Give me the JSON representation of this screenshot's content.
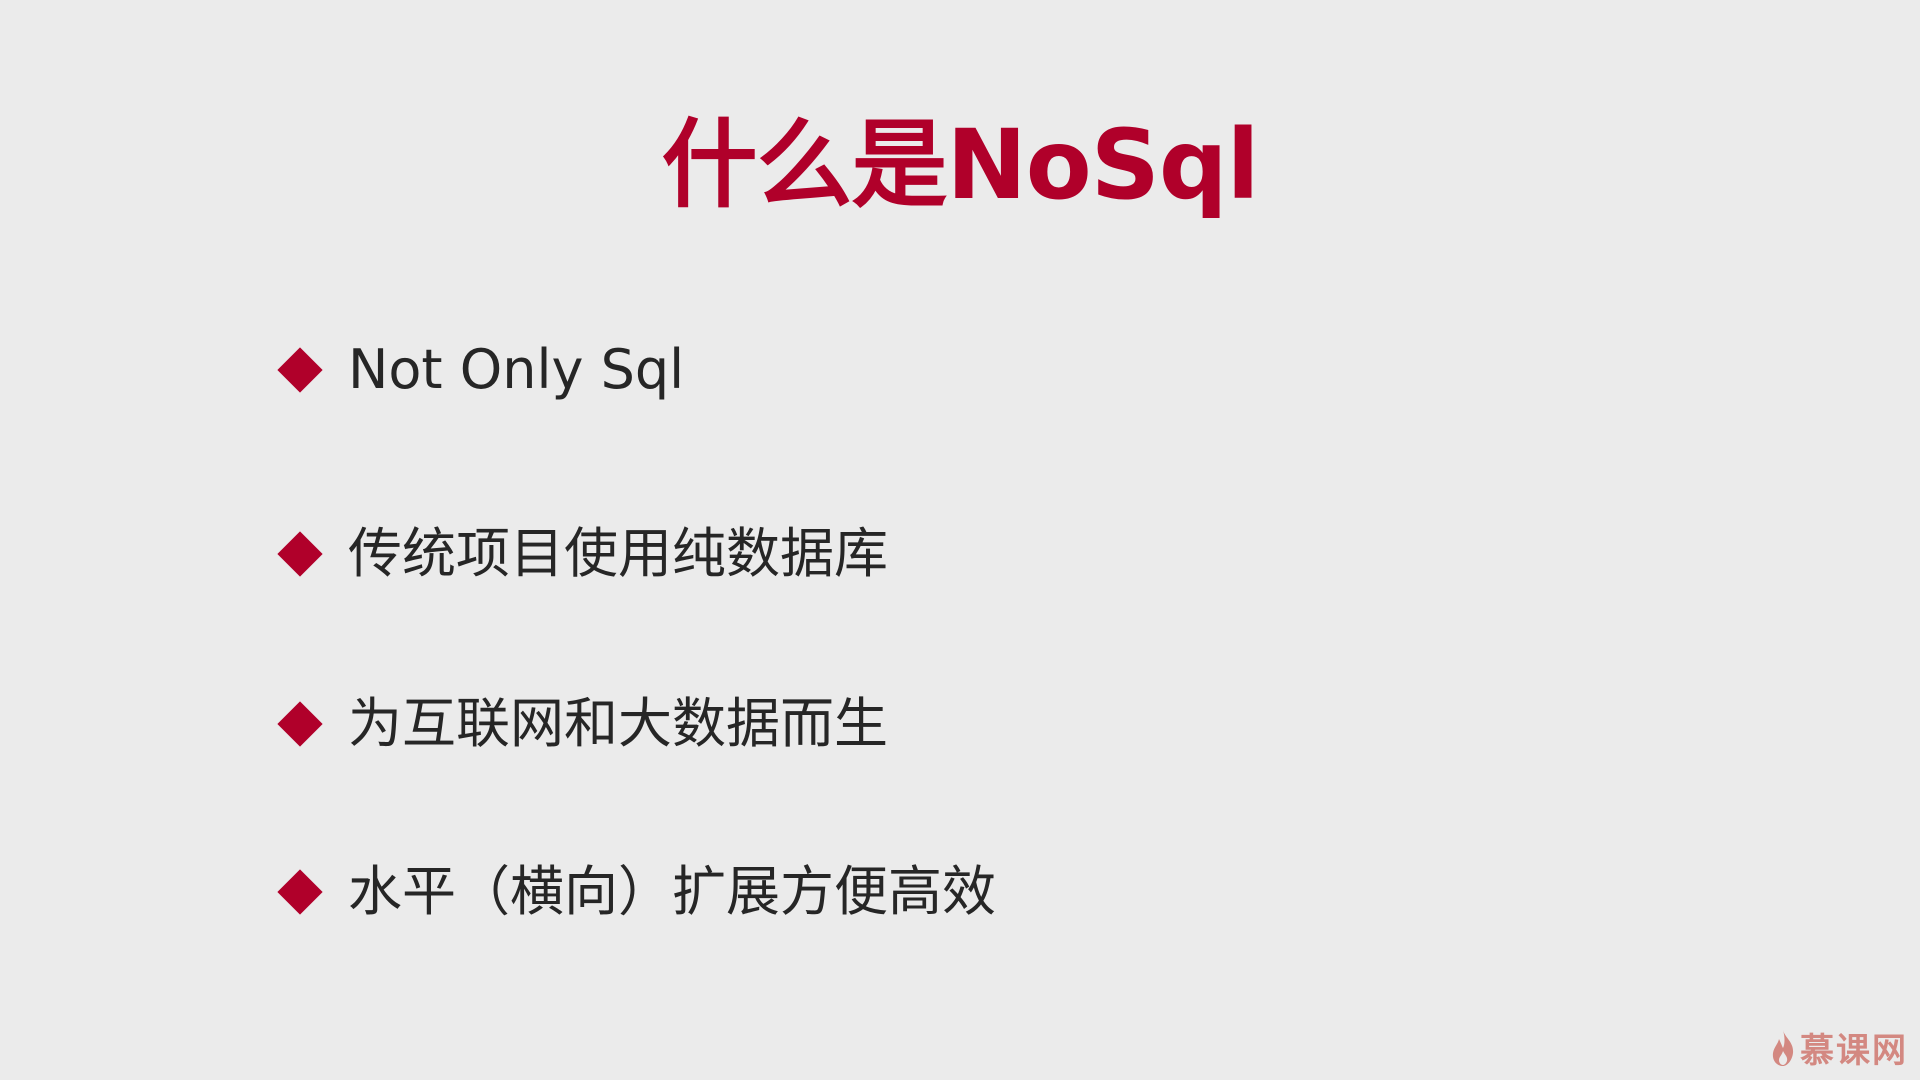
{
  "slide": {
    "title": "什么是NoSql",
    "bullets": [
      "Not Only Sql",
      "传统项目使用纯数据库",
      "为互联网和大数据而生",
      "水平（横向）扩展方便高效"
    ],
    "accent_color": "#b0002a",
    "bullet_icon": "diamond-icon"
  },
  "watermark": {
    "text": "慕课网",
    "icon": "flame-icon"
  }
}
